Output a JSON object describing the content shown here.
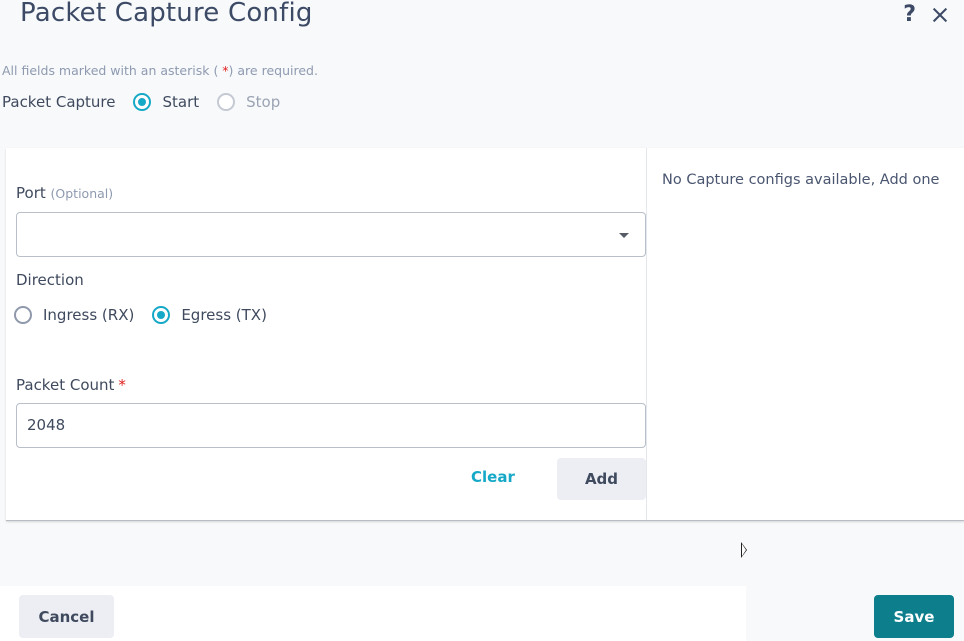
{
  "dialog": {
    "title": "Packet Capture Config",
    "help_icon": "help-icon",
    "close_icon": "close-icon"
  },
  "required_note": {
    "prefix": "All fields marked with an asterisk ( ",
    "star": "*",
    "suffix": ") are required."
  },
  "packet_capture": {
    "label": "Packet Capture",
    "options": [
      {
        "label": "Start",
        "selected": true
      },
      {
        "label": "Stop",
        "selected": false
      }
    ]
  },
  "form": {
    "port": {
      "label": "Port",
      "optional_hint": "(Optional)",
      "value": ""
    },
    "direction": {
      "label": "Direction",
      "options": [
        {
          "label": "Ingress (RX)",
          "selected": false
        },
        {
          "label": "Egress (TX)",
          "selected": true
        }
      ]
    },
    "packet_count": {
      "label": "Packet Count",
      "required_mark": "*",
      "value": "2048"
    },
    "clear_label": "Clear",
    "add_label": "Add"
  },
  "configs_panel": {
    "empty_message": "No Capture configs available, Add one"
  },
  "footer": {
    "cancel_label": "Cancel",
    "save_label": "Save"
  },
  "colors": {
    "accent": "#16a9c7",
    "primary_button": "#0d7f8c",
    "required": "#e02020"
  }
}
